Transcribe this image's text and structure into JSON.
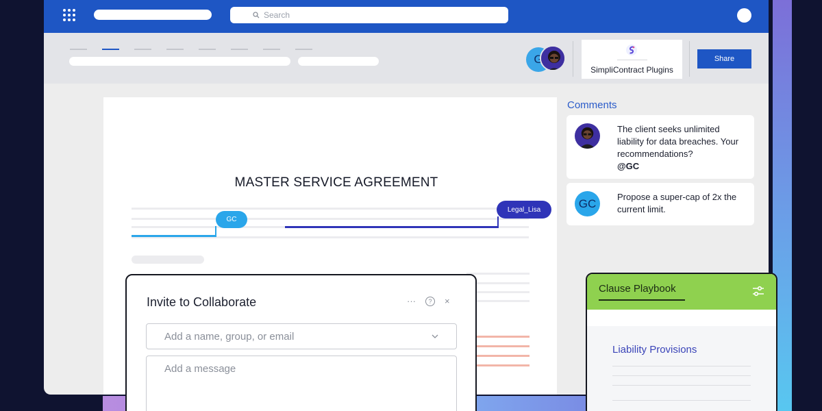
{
  "topbar": {
    "search_placeholder": "Search"
  },
  "ribbon": {
    "plugins_label": "SimpliContract Plugins",
    "share_label": "Share",
    "collaborator_initials": "G"
  },
  "document": {
    "title": "MASTER SERVICE AGREEMENT",
    "tags": {
      "gc": "GC",
      "legal": "Legal_Lisa"
    }
  },
  "comments": {
    "heading": "Comments",
    "items": [
      {
        "text": "The client seeks unlimited liability for data breaches. Your recommendations?",
        "mention": "@GC"
      },
      {
        "avatar_initials": "GC",
        "text": "Propose a super-cap of 2x the current limit."
      }
    ]
  },
  "invite_dialog": {
    "title": "Invite to Collaborate",
    "more_icon": "···",
    "help_icon": "?",
    "close_icon": "×",
    "name_placeholder": "Add a name, group, or email",
    "message_placeholder": "Add a message"
  },
  "playbook": {
    "title": "Clause Playbook",
    "section": "Liability Provisions"
  },
  "colors": {
    "brand_blue": "#1e56c4",
    "gc_blue": "#2aa6ea",
    "legal_indigo": "#2f34b8",
    "playbook_green": "#8fd14f"
  }
}
